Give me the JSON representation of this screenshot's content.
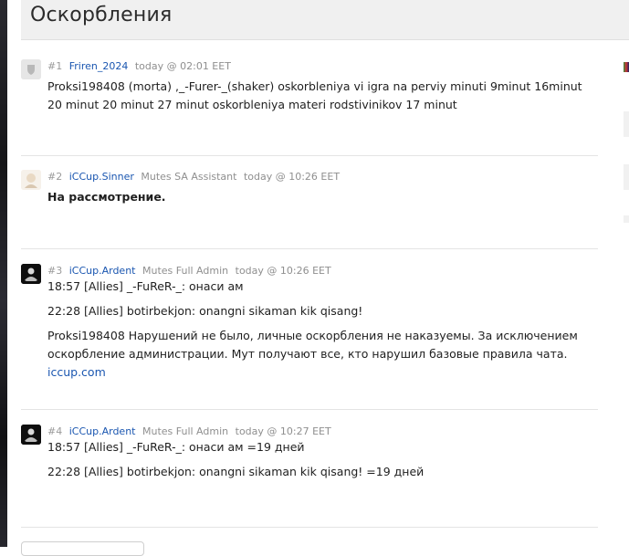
{
  "page": {
    "title": "Оскорбления"
  },
  "posts": [
    {
      "num": "#1",
      "user": "Friren_2024",
      "role": "",
      "time": "today @ 02:01 EET",
      "lines": [
        "Proksi198408 (morta) ,_-Furer-_(shaker) oskorbleniya vi igra na perviy minuti 9minut 16minut 20 minut 20 minut 27 minut oskorbleniya materi rodstivinikov 17 minut"
      ]
    },
    {
      "num": "#2",
      "user": "iCCup.Sinner",
      "role": "Mutes SA Assistant",
      "time": "today @ 10:26 EET",
      "lines": [
        "На рассмотрение."
      ]
    },
    {
      "num": "#3",
      "user": "iCCup.Ardent",
      "role": "Mutes Full Admin",
      "time": "today @ 10:26 EET",
      "lines": [
        "18:57 [Allies] _-FuReR-_: онаси ам",
        "22:28 [Allies] botirbekjon: onangni sikaman kik qisang!",
        "Proksi198408 Нарушений не было, личные оскорбления не наказуемы. За исключением оскорбление администрации. Мут получают все, кто нарушил базовые правила чата."
      ],
      "link": "iccup.com"
    },
    {
      "num": "#4",
      "user": "iCCup.Ardent",
      "role": "Mutes Full Admin",
      "time": "today @ 10:27 EET",
      "lines": [
        "18:57 [Allies] _-FuReR-_: онаси ам =19 дней",
        "22:28 [Allies] botirbekjon: onangni sikaman kik qisang! =19 дней"
      ]
    }
  ],
  "colors": {
    "link": "#1a56b0",
    "meta": "#8f8f8f",
    "header_bg": "#f0f0f0"
  }
}
